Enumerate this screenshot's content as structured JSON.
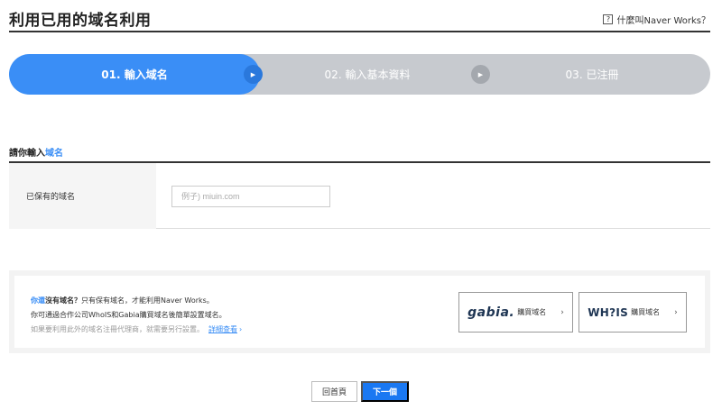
{
  "header": {
    "title": "利用已用的域名利用",
    "help_icon": "?",
    "help_link": "什麼叫Naver Works？"
  },
  "stepper": {
    "steps": [
      {
        "label": "01. 輸入域名",
        "state": "active"
      },
      {
        "label": "02. 輸入基本資料",
        "state": "inactive"
      },
      {
        "label": "03. 已注冊",
        "state": "inactive"
      }
    ]
  },
  "colors": {
    "accent": "#3a8ef6",
    "step_inactive": "#c7cacf",
    "next_button": "#1a78f2"
  },
  "form": {
    "section_title_prefix": "請你輸入",
    "section_title_accent": "域名",
    "domain_label": "已保有的域名",
    "domain_value": "",
    "domain_placeholder": "例子) miuin.com"
  },
  "info": {
    "line1_accent": "你還",
    "line1_bold": "沒有域名？",
    "line1_rest": "只有保有域名，才能利用Naver Works。",
    "line2": "你可通過合作公司WhoIS和Gabia購買域名後簡單設置域名。",
    "line3": "如果要利用此外的域名注冊代理商，就需要另行設置。",
    "detail_link": "詳細查看",
    "detail_chevron": "›",
    "vendors": [
      {
        "brand": "gabia.",
        "action": "購買域名",
        "chevron": "›"
      },
      {
        "brand": "WH?IS",
        "action": "購買域名",
        "chevron": "›"
      }
    ]
  },
  "actions": {
    "home_label": "回首頁",
    "next_label": "下一個"
  }
}
